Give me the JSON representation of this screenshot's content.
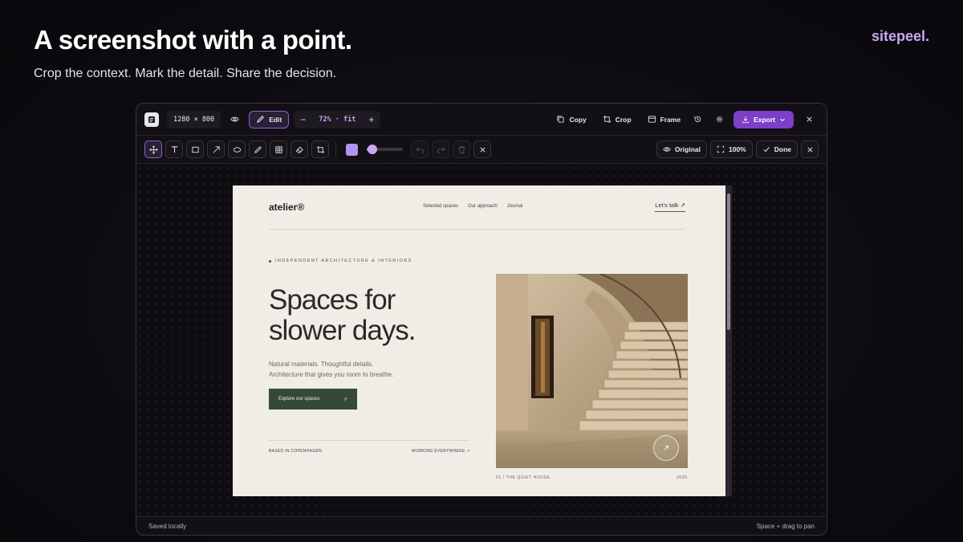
{
  "hero": {
    "title": "A screenshot with a point.",
    "subtitle": "Crop the context. Mark the detail. Share the decision.",
    "brand": "sitepeel."
  },
  "topbar": {
    "app_icon": "document-icon",
    "dimensions": "1280 × 800",
    "edit_label": "Edit",
    "zoom_value": "72% · fit",
    "copy_label": "Copy",
    "crop_label": "Crop",
    "frame_label": "Frame",
    "export_label": "Export"
  },
  "toolbar": {
    "tools": [
      "move",
      "text",
      "rectangle",
      "arrow",
      "ellipse",
      "pen",
      "grid",
      "eraser",
      "crop"
    ],
    "active_tool": "move",
    "color": "#b592f0",
    "stroke_level": 0.15,
    "original_label": "Original",
    "zoom_label": "100%",
    "done_label": "Done"
  },
  "page": {
    "logo": "atelier®",
    "nav": [
      "Selected spaces",
      "Our approach",
      "Journal"
    ],
    "talk": "Let's talk ↗",
    "eyebrow": "INDEPENDENT ARCHITECTURE & INTERIORS",
    "headline_line1": "Spaces for",
    "headline_line2": "slower days.",
    "body_line1": "Natural materials. Thoughtful details.",
    "body_line2": "Architecture that gives you room to breathe.",
    "cta": "Explore our spaces",
    "cta_arrow": "↗",
    "based": "BASED IN COPENHAGEN",
    "working": "WORKING EVERYWHERE ↗",
    "photo_caption": "01 / THE QUIET HOUSE",
    "photo_year": "2026"
  },
  "status": {
    "left": "Saved locally",
    "right": "Space + drag to pan"
  },
  "colors": {
    "accent": "#7d3fc8",
    "accent_light": "#c9a6f5",
    "cta_green": "#344a36",
    "page_bg": "#efede6"
  }
}
